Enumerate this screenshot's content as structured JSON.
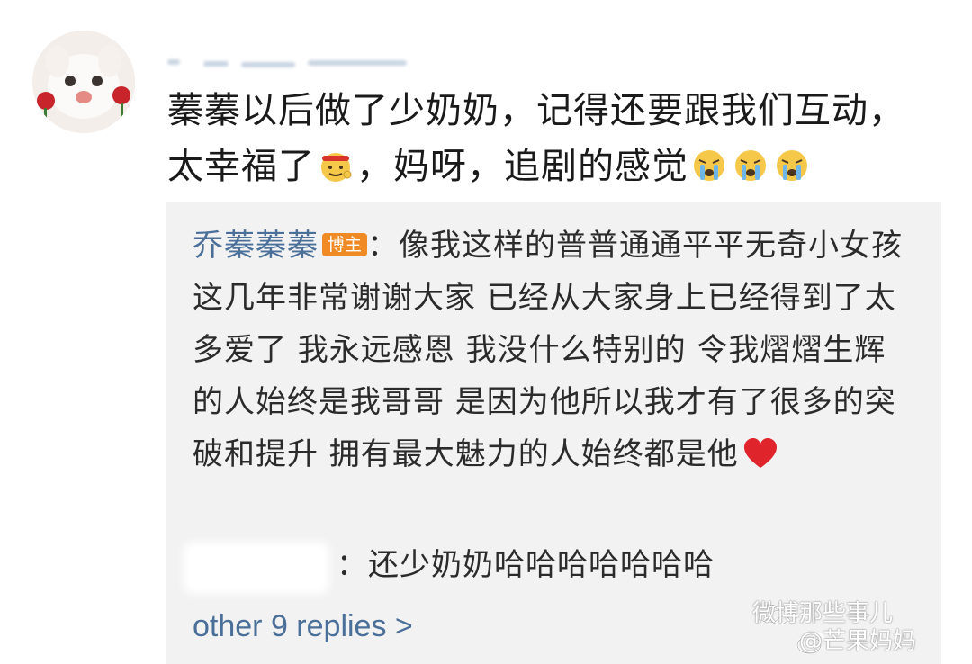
{
  "comment": {
    "text_line1": "蓁蓁以后做了少奶奶，记得还要跟我们互动，",
    "text_line2_a": "太幸福了",
    "text_line2_b": "，妈呀，追剧的感觉"
  },
  "reply": {
    "author": "乔蓁蓁蓁",
    "badge": "博主",
    "separator": "：",
    "text": "像我这样的普普通通平平无奇小女孩 这几年非常谢谢大家 已经从大家身上已经得到了太多爱了 我永远感恩 我没什么特别的 令我熠熠生辉的人始终是我哥哥 是因为他所以我才有了很多的突破和提升 拥有最大魅力的人始终都是他"
  },
  "sub_reply": {
    "separator": "：",
    "text": "还少奶奶哈哈哈哈哈哈哈"
  },
  "more_replies": "other 9 replies >",
  "watermark": {
    "line1": "微博那些事儿",
    "line2": "@芒果妈妈"
  },
  "icons": {
    "avatar": "cat-avatar-icon",
    "emoji_happy": "headband-emoji-icon",
    "emoji_cry": "crying-emoji-icon",
    "heart": "heart-icon"
  },
  "colors": {
    "link": "#4a6f99",
    "badge": "#f08a24",
    "reply_bg": "#f2f2f2",
    "heart": "#e0242c"
  }
}
